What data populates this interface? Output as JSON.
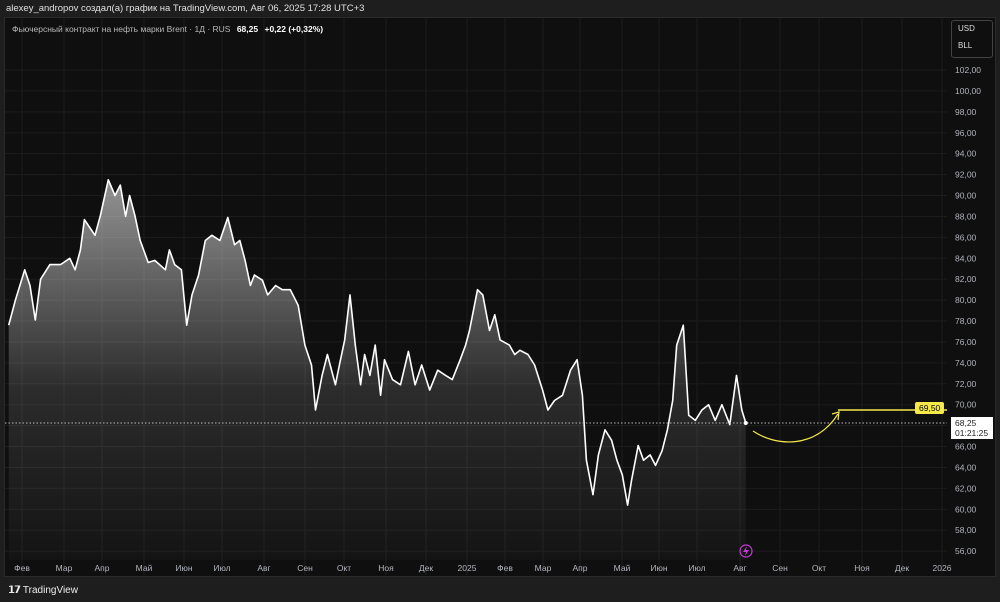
{
  "header": {
    "attribution": "alexey_andropov создал(а) график на TradingView.com, Авг 06, 2025 17:28 UTC+3"
  },
  "legend": {
    "symbol": "Фьючерсный контракт на нефть марки Brent · 1Д · RUS",
    "price": "68,25",
    "change": "+0,22 (+0,32%)"
  },
  "units": {
    "currency": "USD",
    "unit": "BLL"
  },
  "price_labels": {
    "target": "69,50",
    "current": "68,25",
    "countdown": "01:21:25"
  },
  "footer": {
    "brand": "TradingView",
    "logo": "TV"
  },
  "colors": {
    "line": "#ffffff",
    "target": "#f5e94a",
    "bg": "#0f0f0f",
    "event": "#c33ad6"
  },
  "chart_data": {
    "type": "area",
    "title": "Фьючерсный контракт на нефть марки Brent · 1Д",
    "x_unit": "days since 2024-02-01",
    "ylim": [
      55,
      104
    ],
    "y_ticks": [
      "56,00",
      "58,00",
      "60,00",
      "62,00",
      "64,00",
      "66,00",
      "68,00",
      "70,00",
      "72,00",
      "74,00",
      "76,00",
      "78,00",
      "80,00",
      "82,00",
      "84,00",
      "86,00",
      "88,00",
      "90,00",
      "92,00",
      "94,00",
      "96,00",
      "98,00",
      "100,00",
      "102,00"
    ],
    "x_ticks": [
      "Фев",
      "Мар",
      "Апр",
      "Май",
      "Июн",
      "Июл",
      "Авг",
      "Сен",
      "Окт",
      "Ноя",
      "Дек",
      "2025",
      "Фев",
      "Мар",
      "Апр",
      "Май",
      "Июн",
      "Июл",
      "Авг",
      "Сен",
      "Окт",
      "Ноя",
      "Дек",
      "2026"
    ],
    "points": [
      [
        -10,
        77.6
      ],
      [
        -5,
        80
      ],
      [
        2,
        82.9
      ],
      [
        6,
        81.4
      ],
      [
        10,
        78.1
      ],
      [
        14,
        82
      ],
      [
        21,
        83.4
      ],
      [
        29,
        83.4
      ],
      [
        36,
        84
      ],
      [
        40,
        82.9
      ],
      [
        44,
        84.8
      ],
      [
        47,
        87.7
      ],
      [
        55,
        86.2
      ],
      [
        59,
        88.1
      ],
      [
        65,
        91.5
      ],
      [
        70,
        90
      ],
      [
        74,
        91
      ],
      [
        78,
        88
      ],
      [
        81,
        90
      ],
      [
        85,
        88.1
      ],
      [
        89,
        85.7
      ],
      [
        95,
        83.6
      ],
      [
        100,
        83.8
      ],
      [
        108,
        82.9
      ],
      [
        111,
        84.8
      ],
      [
        115,
        83.4
      ],
      [
        120,
        82.9
      ],
      [
        124,
        77.6
      ],
      [
        128,
        80.5
      ],
      [
        133,
        82.4
      ],
      [
        138,
        85.7
      ],
      [
        143,
        86.2
      ],
      [
        149,
        85.7
      ],
      [
        155,
        87.9
      ],
      [
        160,
        85.3
      ],
      [
        164,
        85.7
      ],
      [
        168,
        83.8
      ],
      [
        172,
        81.4
      ],
      [
        175,
        82.4
      ],
      [
        181,
        81.9
      ],
      [
        185,
        80.5
      ],
      [
        191,
        81.4
      ],
      [
        196,
        81
      ],
      [
        202,
        81
      ],
      [
        208,
        79.5
      ],
      [
        213,
        75.7
      ],
      [
        218,
        73.8
      ],
      [
        221,
        69.5
      ],
      [
        226,
        72.8
      ],
      [
        230,
        74.8
      ],
      [
        236,
        71.9
      ],
      [
        239,
        73.8
      ],
      [
        243,
        76.2
      ],
      [
        247,
        80.5
      ],
      [
        251,
        75.7
      ],
      [
        255,
        71.9
      ],
      [
        258,
        74.8
      ],
      [
        262,
        72.8
      ],
      [
        266,
        75.7
      ],
      [
        270,
        70.9
      ],
      [
        273,
        74.3
      ],
      [
        279,
        72.4
      ],
      [
        285,
        71.9
      ],
      [
        291,
        75.1
      ],
      [
        296,
        71.9
      ],
      [
        301,
        73.8
      ],
      [
        307,
        71.4
      ],
      [
        313,
        73.3
      ],
      [
        319,
        72.8
      ],
      [
        324,
        72.4
      ],
      [
        330,
        74.3
      ],
      [
        334,
        75.7
      ],
      [
        337,
        77.1
      ],
      [
        343,
        81
      ],
      [
        347,
        80.5
      ],
      [
        352,
        77.1
      ],
      [
        356,
        78.6
      ],
      [
        360,
        76.2
      ],
      [
        367,
        75.7
      ],
      [
        371,
        74.8
      ],
      [
        375,
        75.2
      ],
      [
        381,
        74.8
      ],
      [
        386,
        73.8
      ],
      [
        392,
        71.4
      ],
      [
        396,
        69.5
      ],
      [
        401,
        70.4
      ],
      [
        407,
        70.9
      ],
      [
        413,
        73.3
      ],
      [
        418,
        74.3
      ],
      [
        422,
        70.9
      ],
      [
        425,
        64.7
      ],
      [
        430,
        61.4
      ],
      [
        434,
        65.2
      ],
      [
        439,
        67.6
      ],
      [
        444,
        66.6
      ],
      [
        448,
        64.7
      ],
      [
        452,
        63.3
      ],
      [
        456,
        60.4
      ],
      [
        459,
        62.8
      ],
      [
        464,
        66.1
      ],
      [
        468,
        64.7
      ],
      [
        473,
        65.2
      ],
      [
        477,
        64.2
      ],
      [
        482,
        65.6
      ],
      [
        486,
        67.6
      ],
      [
        490,
        70.4
      ],
      [
        493,
        75.7
      ],
      [
        498,
        77.6
      ],
      [
        502,
        69
      ],
      [
        507,
        68.5
      ],
      [
        512,
        69.5
      ],
      [
        517,
        70
      ],
      [
        522,
        68.5
      ],
      [
        527,
        70
      ],
      [
        533,
        68.1
      ],
      [
        538,
        72.8
      ],
      [
        542,
        69.5
      ],
      [
        545,
        68.25
      ]
    ],
    "last": 68.25,
    "target_level": 69.5
  }
}
